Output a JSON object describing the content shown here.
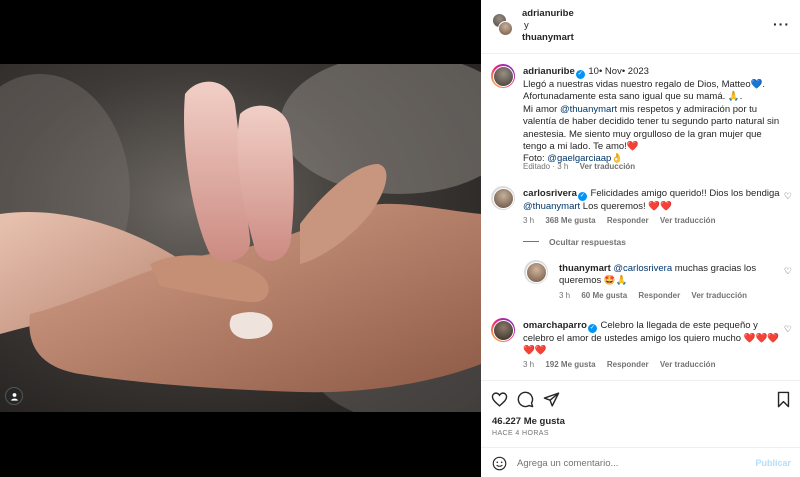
{
  "header": {
    "user1": "adrianuribe",
    "connector": "y",
    "user2": "thuanymart"
  },
  "caption": {
    "username": "adrianuribe",
    "date": "10• Nov• 2023",
    "line1": "Llegó a nuestras vidas nuestro regalo de Dios, Matteo💙.",
    "line2": "Afortunadamente esta sano igual que su mamá. 🙏.",
    "line3_prefix": "Mi amor ",
    "line3_mention": "@thuanymart",
    "line3_rest": " mis respetos y admiración por tu valentía de haber decidido tener tu segundo parto natural sin anestesia. Me siento muy orgulloso de la gran mujer que tengo a mi lado. Te amo!❤️",
    "photo_label": "Foto: ",
    "photo_mention": "@gaelgarciaap",
    "photo_suffix": "👌",
    "edited": "Editado · 3 h",
    "see_translation": "Ver traducción"
  },
  "comments": [
    {
      "username": "carlosrivera",
      "text": " Felicidades amigo querido!! Dios los bendiga ",
      "mention": "@thuanymart",
      "text2": " Los queremos! ❤️❤️",
      "time": "3 h",
      "likes": "368 Me gusta",
      "reply": "Responder",
      "translate": "Ver traducción"
    },
    {
      "username": "thuanymart",
      "mention": "@carlosrivera",
      "text": " muchas gracias los queremos 🤩🙏",
      "time": "3 h",
      "likes": "60 Me gusta",
      "reply": "Responder",
      "translate": "Ver traducción"
    },
    {
      "username": "omarchaparro",
      "text": " Celebro la llegada de este pequeño y celebro el amor de ustedes amigo los quiero mucho ❤️❤️❤️❤️❤️",
      "time": "3 h",
      "likes": "192 Me gusta",
      "reply": "Responder",
      "translate": "Ver traducción"
    }
  ],
  "hide_replies": "Ocultar respuestas",
  "likes_count": "46.227 Me gusta",
  "posted_ago": "HACE 4 HORAS",
  "comment_box": {
    "placeholder": "Agrega un comentario...",
    "publish": "Publicar"
  },
  "colors": {
    "accent": "#0095f6",
    "mention": "#00376b",
    "publish_disabled": "#b2dffc"
  }
}
